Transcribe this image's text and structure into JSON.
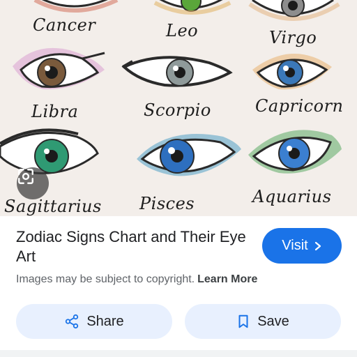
{
  "image": {
    "eye_labels": {
      "cancer": "Cancer",
      "leo": "Leo",
      "virgo": "Virgo",
      "libra": "Libra",
      "scorpio": "Scorpio",
      "capricorn": "Capricorn",
      "sagittarius": "Sagittarius",
      "pisces": "Pisces",
      "aquarius": "Aquarius"
    },
    "lens_icon": "google-lens-icon"
  },
  "result": {
    "title": "Zodiac Signs Chart and Their Eye Art",
    "visit_label": "Visit",
    "visit_icon": "chevron-right-icon",
    "copyright_text": "Images may be subject to copyright.",
    "learn_more_label": "Learn More"
  },
  "actions": {
    "share_label": "Share",
    "share_icon": "share-icon",
    "save_label": "Save",
    "save_icon": "bookmark-icon"
  },
  "colors": {
    "accent": "#1a73e8",
    "button_bg": "#e8f0fe",
    "text_primary": "#202124",
    "text_secondary": "#5f6368"
  }
}
